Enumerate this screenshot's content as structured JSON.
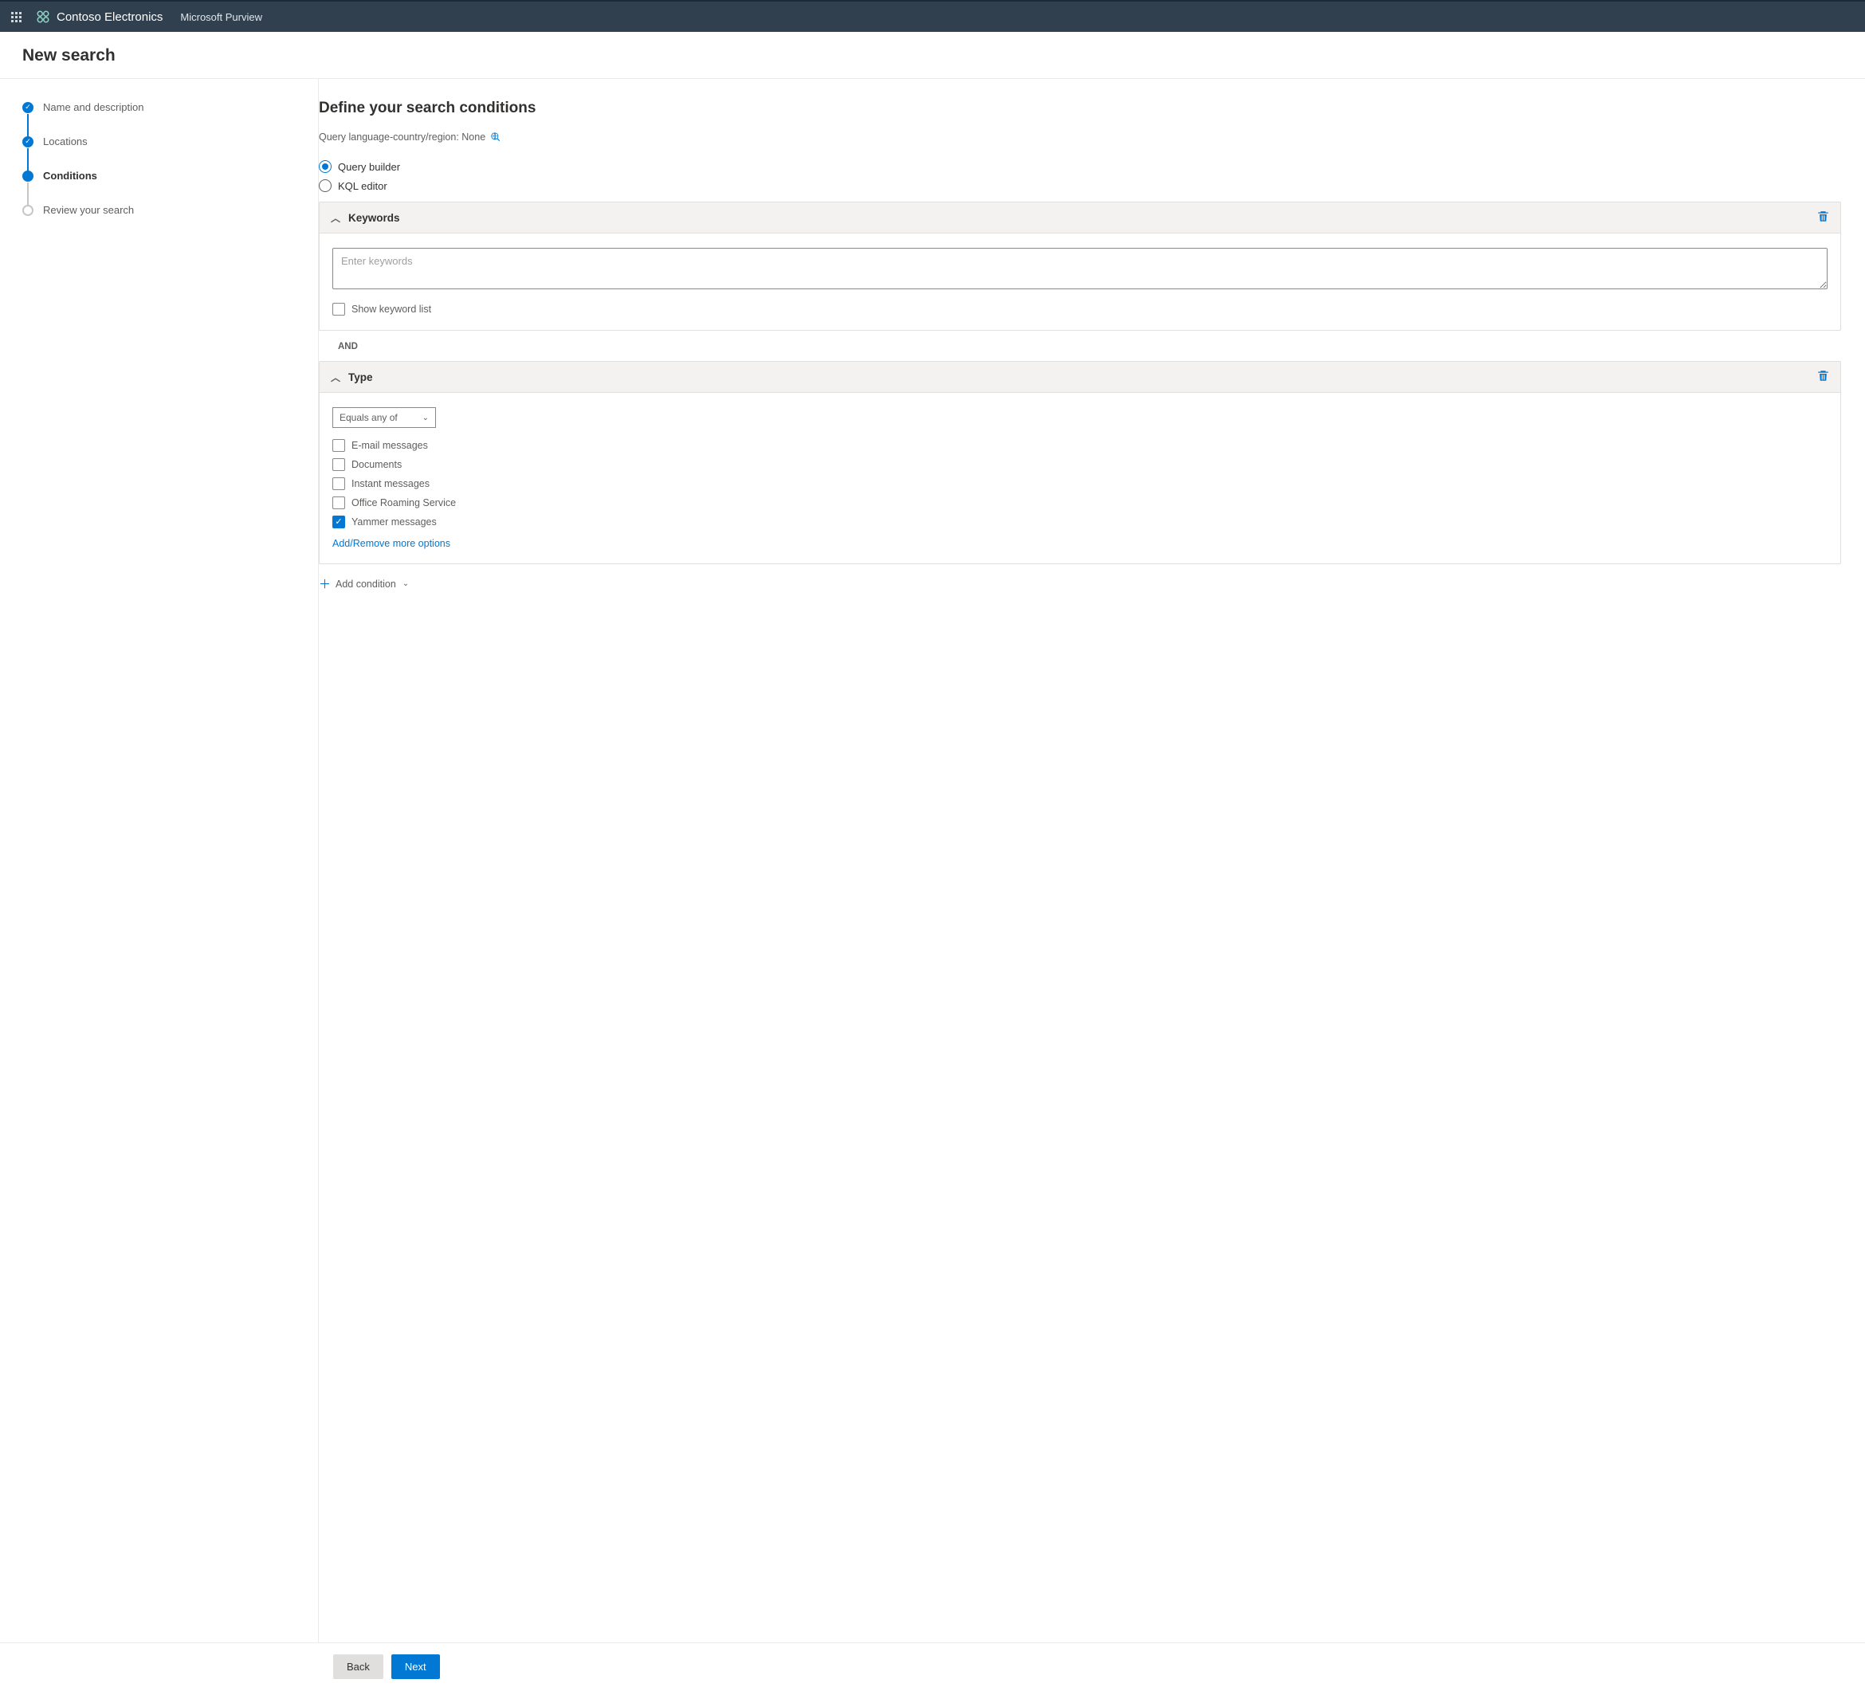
{
  "topbar": {
    "org": "Contoso Electronics",
    "product": "Microsoft Purview"
  },
  "page_title": "New search",
  "steps": [
    {
      "label": "Name and description",
      "state": "completed"
    },
    {
      "label": "Locations",
      "state": "completed"
    },
    {
      "label": "Conditions",
      "state": "current"
    },
    {
      "label": "Review your search",
      "state": "pending"
    }
  ],
  "main": {
    "heading": "Define your search conditions",
    "region_label": "Query language-country/region: None",
    "radios": {
      "query_builder": "Query builder",
      "kql_editor": "KQL editor"
    },
    "keywords_card": {
      "title": "Keywords",
      "placeholder": "Enter keywords",
      "show_list_label": "Show keyword list"
    },
    "and_label": "AND",
    "type_card": {
      "title": "Type",
      "operator": "Equals any of",
      "options": [
        {
          "label": "E-mail messages",
          "checked": false
        },
        {
          "label": "Documents",
          "checked": false
        },
        {
          "label": "Instant messages",
          "checked": false
        },
        {
          "label": "Office Roaming Service",
          "checked": false
        },
        {
          "label": "Yammer messages",
          "checked": true
        }
      ],
      "more_link": "Add/Remove more options"
    },
    "add_condition": "Add condition"
  },
  "footer": {
    "back": "Back",
    "next": "Next"
  }
}
